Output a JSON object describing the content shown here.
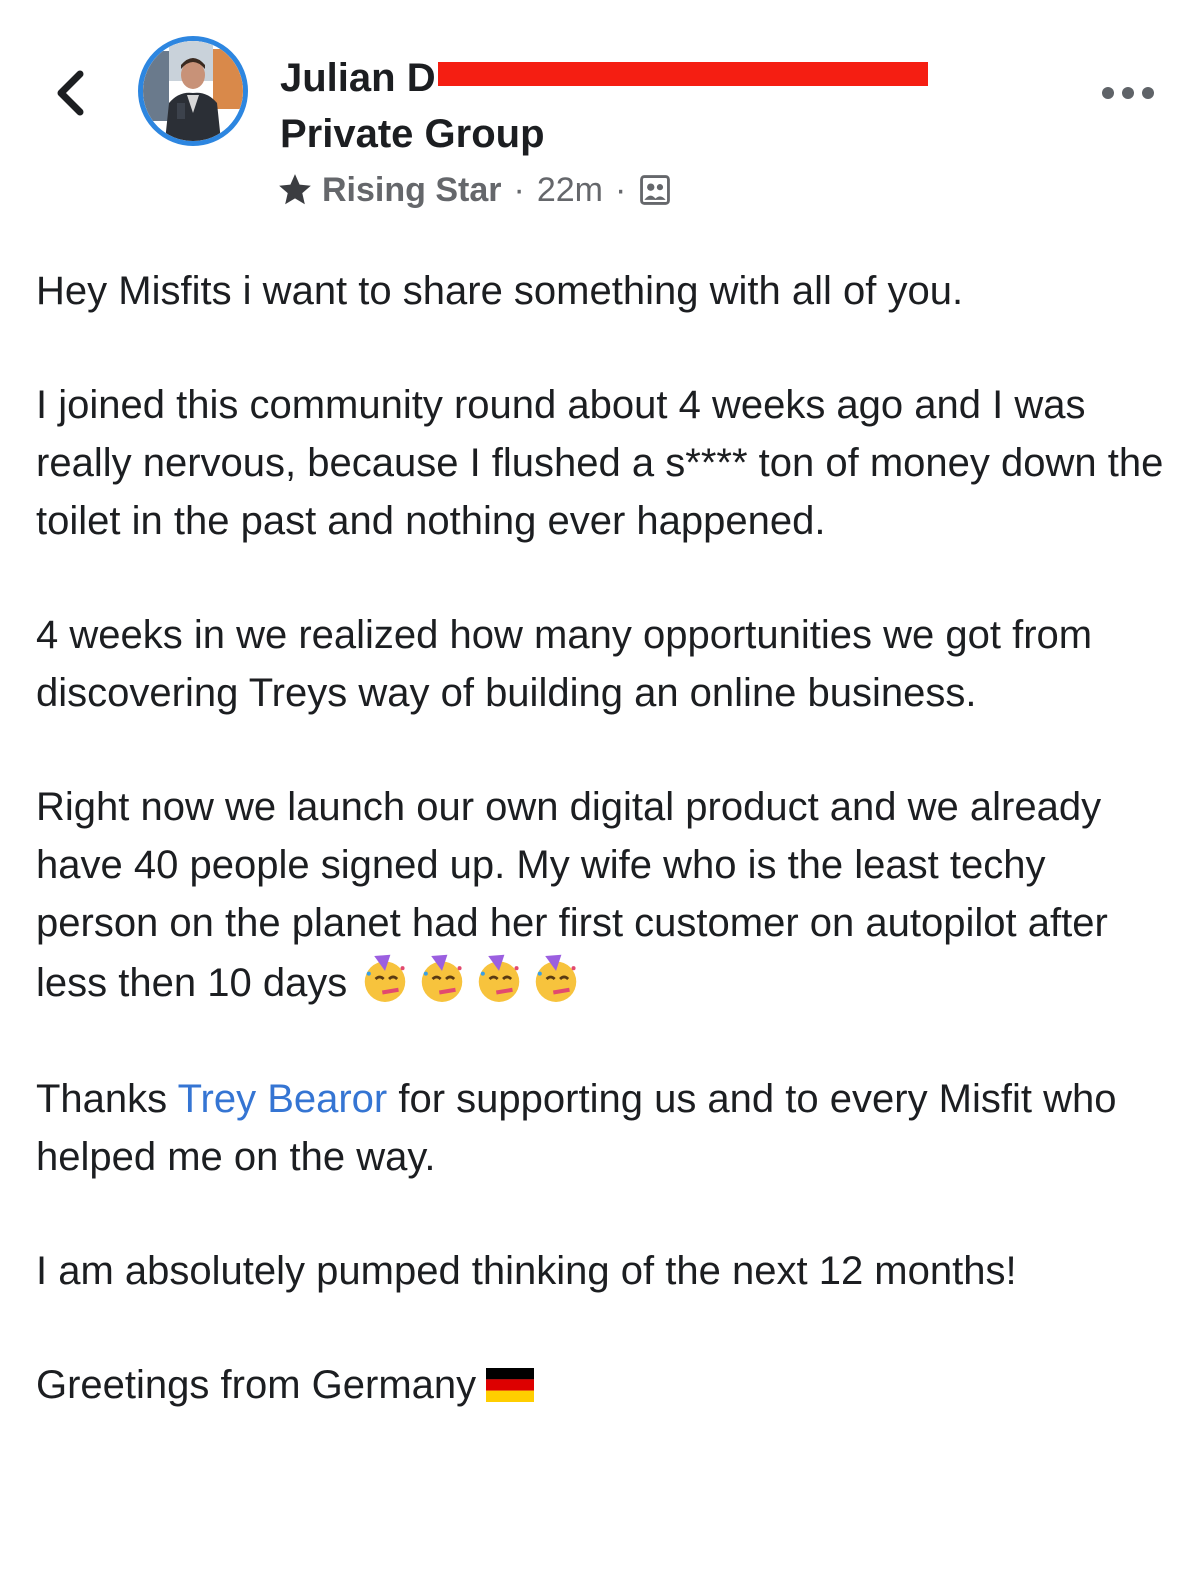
{
  "header": {
    "author_name": "Julian D",
    "group_label": "Private Group",
    "badge": "Rising Star",
    "separator": "·",
    "timestamp": "22m",
    "back_icon": "chevron-left-icon",
    "more_icon": "more-horizontal-icon",
    "audience_icon": "group-audience-icon",
    "badge_icon": "star-icon",
    "redaction_color": "#f51e12",
    "avatar_ring_color": "#2d86e0"
  },
  "post": {
    "p1": "Hey Misfits i want to share something with all of you.",
    "p2": "I joined this community round about 4 weeks ago and I was really nervous, because I flushed a s**** ton of money down the toilet in the past and nothing ever happened.",
    "p3": "4 weeks in we realized how many opportunities we got from discovering Treys way of building an online business.",
    "p4_text": "Right now we launch our own digital product and we already have 40 people signed up. My wife who is the least techy person on the planet had her first customer on autopilot after less then 10 days",
    "p4_emojis": [
      "partying-face-emoji",
      "partying-face-emoji",
      "partying-face-emoji",
      "partying-face-emoji"
    ],
    "p5_before": "Thanks ",
    "p5_mention": "Trey Bearor",
    "p5_after": " for supporting us and to every Misfit who helped me on the way.",
    "p6": "I am absolutely pumped thinking of the next 12 months!",
    "p7_text": "Greetings from Germany",
    "p7_flag": "germany-flag-emoji",
    "mention_color": "#3575d3"
  }
}
